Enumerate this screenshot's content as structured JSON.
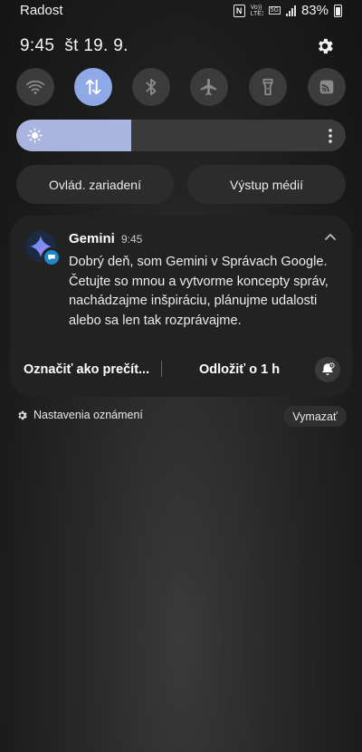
{
  "status_bar": {
    "carrier": "Radost",
    "nfc_icon": "N",
    "volte": "Vo)) LTE1",
    "network": "5G",
    "battery": "83%"
  },
  "header": {
    "time": "9:45",
    "date": "št 19. 9."
  },
  "quick_toggles": [
    {
      "name": "wifi",
      "icon": "wifi-icon",
      "on": false
    },
    {
      "name": "mobile-data",
      "icon": "data-transfer-icon",
      "on": true
    },
    {
      "name": "bluetooth",
      "icon": "bluetooth-icon",
      "on": false
    },
    {
      "name": "airplane",
      "icon": "airplane-icon",
      "on": false
    },
    {
      "name": "flashlight",
      "icon": "flashlight-icon",
      "on": false
    },
    {
      "name": "cast",
      "icon": "cast-icon",
      "on": false
    }
  ],
  "brightness": {
    "level": 0.35
  },
  "buttons": {
    "device_control": "Ovlád. zariadení",
    "media_output": "Výstup médií"
  },
  "notification": {
    "app_name": "Gemini",
    "time": "9:45",
    "body": "Dobrý deň, som Gemini v Správach Google. Četujte so mnou a vytvorme koncepty správ, nachádzajme inšpiráciu, plánujme udalosti alebo sa len tak rozprávajme.",
    "action_mark": "Označiť ako prečít...",
    "action_snooze": "Odložiť o 1 h"
  },
  "footer": {
    "settings_label": "Nastavenia oznámení",
    "clear_label": "Vymazať"
  },
  "colors": {
    "toggle_on": "#8fa8e6",
    "toggle_off": "#3b3b3b",
    "brightness_fill": "#a9b5de"
  }
}
